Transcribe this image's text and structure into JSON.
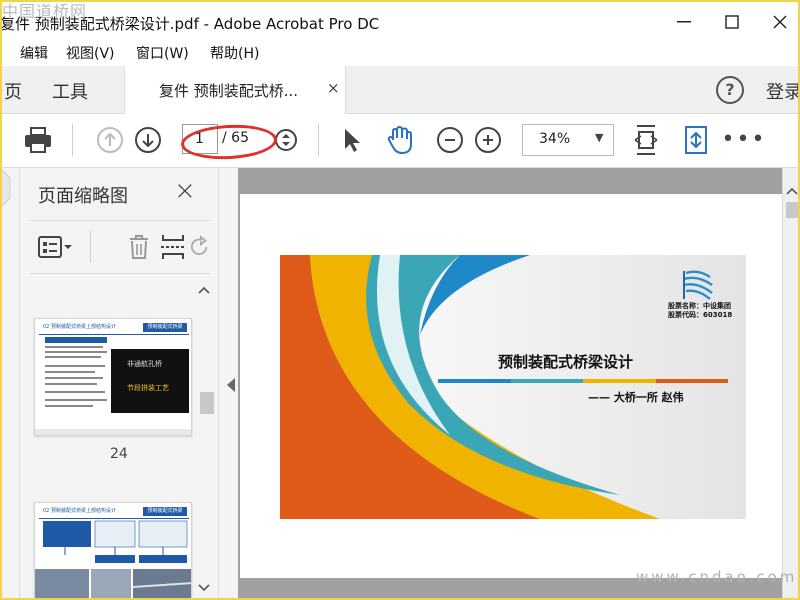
{
  "window": {
    "title": "复件 预制装配式桥梁设计.pdf - Adobe Acrobat Pro DC",
    "watermark_top": "中国道桥网",
    "watermark_bottom": "www.cndao.com"
  },
  "menu": {
    "items": [
      "编辑",
      "视图(V)",
      "窗口(W)",
      "帮助(H)"
    ]
  },
  "tabs": {
    "home_partial": "页",
    "tools": "工具",
    "document": "复件 预制装配式桥...",
    "close": "×",
    "help": "?",
    "login_partial": "登录"
  },
  "toolbar": {
    "page_current": "1",
    "page_total": "/ 65",
    "zoom": "34%"
  },
  "sidebar": {
    "title": "页面缩略图",
    "close": "×",
    "thumbnails": [
      {
        "page_label": "24",
        "header": "02 预制装配式桥梁上部结构设计",
        "header_tag": "预制装配式桥梁",
        "image_text_1": "非通航孔桥",
        "image_text_2": "节段拼装工艺"
      },
      {
        "page_label": "",
        "header": "02 预制装配式桥梁上部结构设计",
        "header_tag": "预制装配式桥梁"
      }
    ]
  },
  "slide": {
    "title": "预制装配式桥梁设计",
    "author": "—— 大桥一所  赵伟",
    "stock_name": "股票名称：中设集团",
    "stock_code": "股票代码：603018",
    "colors": [
      "#1e88c8",
      "#3aa6b6",
      "#f0b400",
      "#e05a1a"
    ]
  },
  "colors": {
    "annotation_red": "#e0302a",
    "frame_yellow": "#f2d34a",
    "acrobat_blue": "#2a72c8"
  },
  "icons": [
    "print-icon",
    "page-up-icon",
    "page-down-icon",
    "page-stepper-icon",
    "select-arrow-icon",
    "hand-icon",
    "zoom-out-icon",
    "zoom-in-icon",
    "fit-page-icon",
    "rotate-page-icon",
    "more-icon",
    "thumbnail-options-icon",
    "trash-icon",
    "insert-page-icon",
    "rotate-icon"
  ]
}
